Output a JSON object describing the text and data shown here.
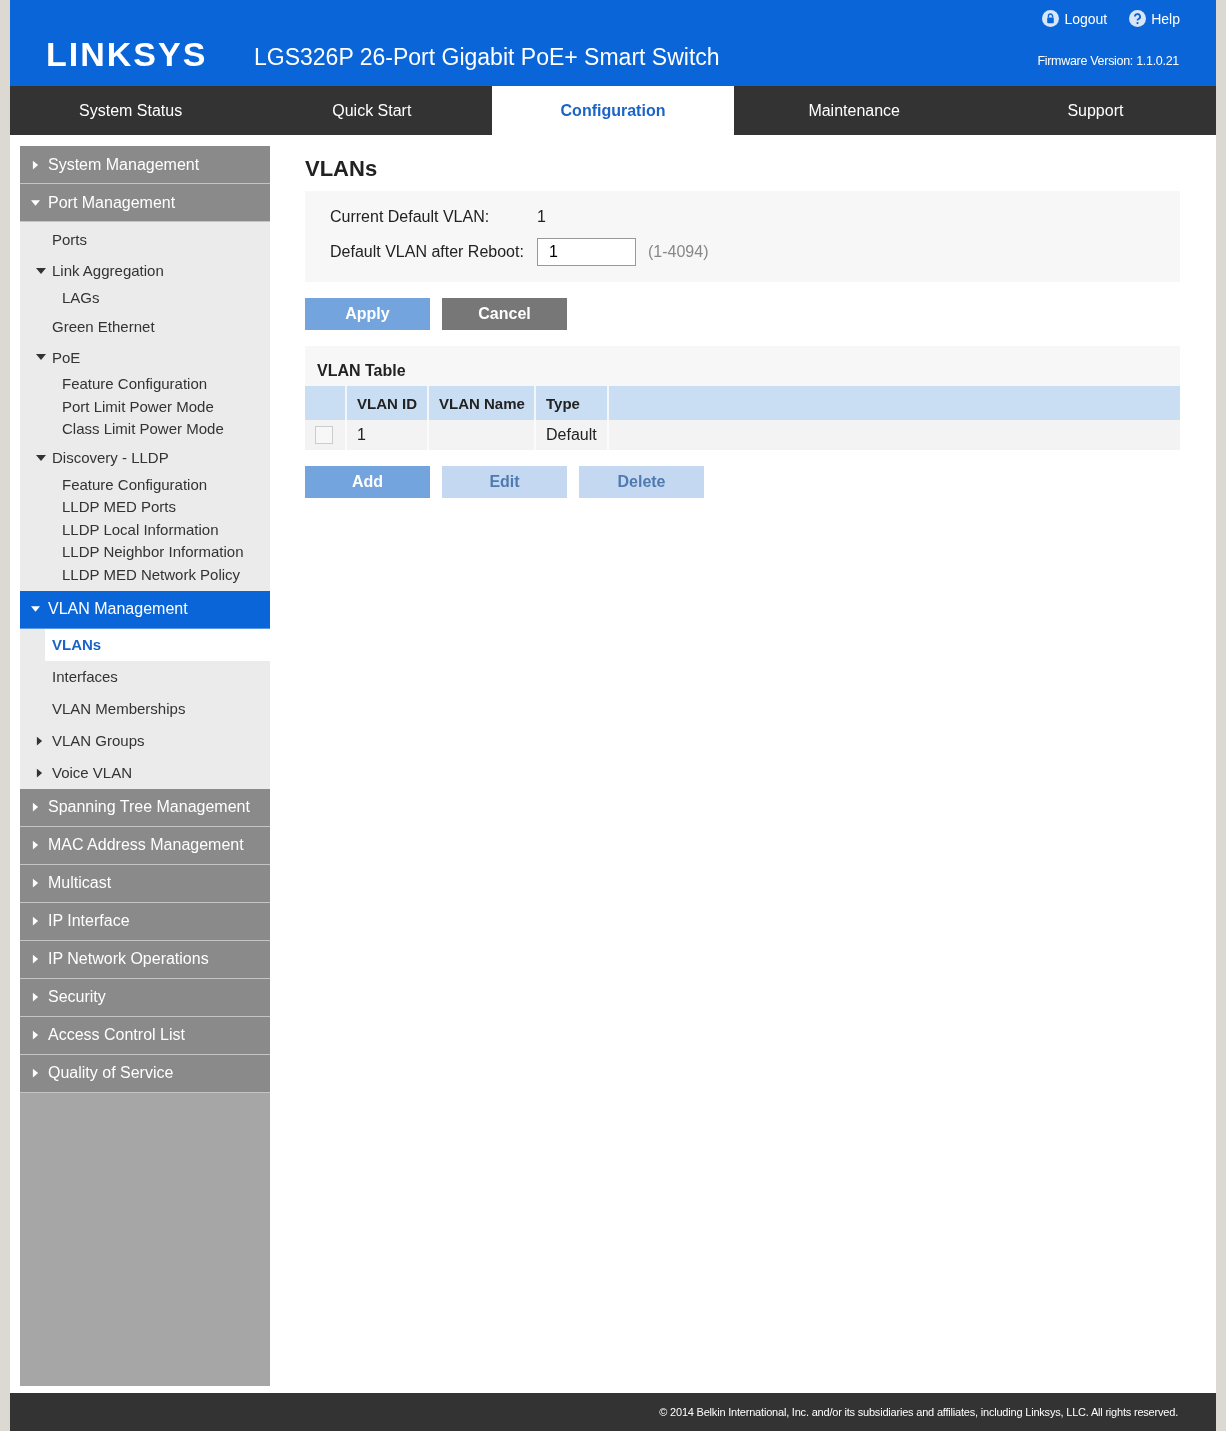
{
  "header": {
    "logo": "LINKSYS",
    "title": "LGS326P 26-Port Gigabit PoE+ Smart Switch",
    "links": [
      {
        "kind": "logout",
        "label": "Logout"
      },
      {
        "kind": "help",
        "label": "Help"
      }
    ],
    "firmware": "Firmware Version: 1.1.0.21"
  },
  "tabs": [
    {
      "label": "System Status",
      "selected": false
    },
    {
      "label": "Quick Start",
      "selected": false
    },
    {
      "label": "Configuration",
      "selected": true
    },
    {
      "label": "Maintenance",
      "selected": false
    },
    {
      "label": "Support",
      "selected": false
    }
  ],
  "sidebar": [
    {
      "label": "System Management",
      "expanded": false,
      "selected": false
    },
    {
      "label": "Port Management",
      "expanded": true,
      "selected": false,
      "children": [
        {
          "label": "Ports",
          "selected": false
        },
        {
          "label": "Link Aggregation",
          "expanded": true,
          "selected": false,
          "children": [
            {
              "label": "LAGs",
              "selected": false
            }
          ]
        },
        {
          "label": "Green Ethernet",
          "selected": false
        },
        {
          "label": "PoE",
          "expanded": true,
          "selected": false,
          "children": [
            {
              "label": "Feature Configuration",
              "selected": false
            },
            {
              "label": "Port Limit Power Mode",
              "selected": false
            },
            {
              "label": "Class Limit Power Mode",
              "selected": false
            }
          ]
        },
        {
          "label": "Discovery - LLDP",
          "expanded": true,
          "selected": false,
          "children": [
            {
              "label": "Feature Configuration",
              "selected": false
            },
            {
              "label": "LLDP MED Ports",
              "selected": false
            },
            {
              "label": "LLDP Local Information",
              "selected": false
            },
            {
              "label": "LLDP Neighbor Information",
              "selected": false
            },
            {
              "label": "LLDP MED Network Policy",
              "selected": false
            }
          ]
        }
      ]
    },
    {
      "label": "VLAN Management",
      "expanded": true,
      "selected": true,
      "children": [
        {
          "label": "VLANs",
          "selected": true
        },
        {
          "label": "Interfaces",
          "selected": false
        },
        {
          "label": "VLAN Memberships",
          "selected": false
        },
        {
          "label": "VLAN Groups",
          "expanded": false,
          "selected": false
        },
        {
          "label": "Voice VLAN",
          "expanded": false,
          "selected": false
        }
      ]
    },
    {
      "label": "Spanning Tree Management",
      "expanded": false,
      "selected": false
    },
    {
      "label": "MAC Address Management",
      "expanded": false,
      "selected": false
    },
    {
      "label": "Multicast",
      "expanded": false,
      "selected": false
    },
    {
      "label": "IP Interface",
      "expanded": false,
      "selected": false
    },
    {
      "label": "IP Network Operations",
      "expanded": false,
      "selected": false
    },
    {
      "label": "Security",
      "expanded": false,
      "selected": false
    },
    {
      "label": "Access Control List",
      "expanded": false,
      "selected": false
    },
    {
      "label": "Quality of Service",
      "expanded": false,
      "selected": false
    }
  ],
  "content": {
    "title": "VLANs",
    "current_default": {
      "label": "Current Default VLAN:",
      "value": "1"
    },
    "default_after_reboot": {
      "label": "Default VLAN after Reboot:",
      "value": "1",
      "hint": "(1-4094)"
    },
    "form_buttons": [
      {
        "label": "Apply",
        "kind": "primary",
        "disabled": false
      },
      {
        "label": "Cancel",
        "kind": "secondary",
        "disabled": false
      }
    ],
    "table": {
      "title": "VLAN Table",
      "columns": [
        "VLAN ID",
        "VLAN Name",
        "Type"
      ],
      "rows": [
        {
          "checked": false,
          "vlan_id": "1",
          "type": "Default"
        }
      ]
    },
    "table_buttons": [
      {
        "label": "Add",
        "kind": "primary",
        "disabled": false
      },
      {
        "label": "Edit",
        "kind": "primary",
        "disabled": true
      },
      {
        "label": "Delete",
        "kind": "primary",
        "disabled": true
      }
    ]
  },
  "footer": "© 2014 Belkin International, Inc. and/or its subsidiaries and affiliates, including Linksys, LLC. All rights reserved."
}
